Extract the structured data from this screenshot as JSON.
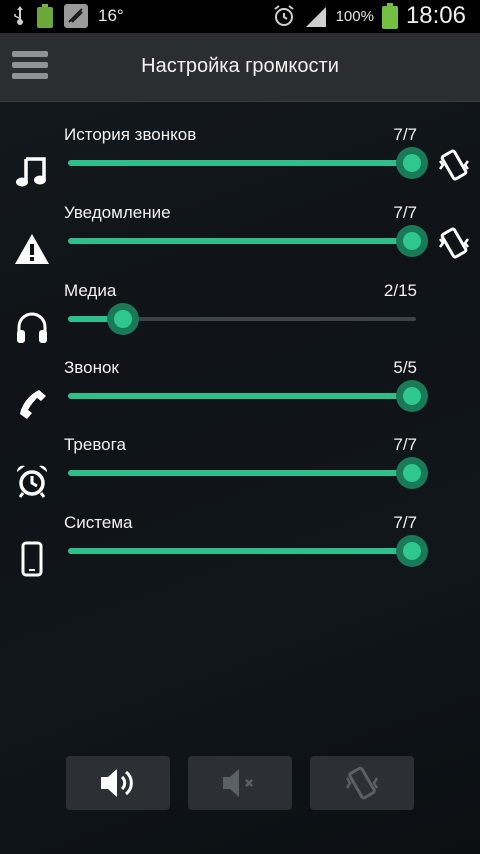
{
  "status_bar": {
    "temperature": "16°",
    "battery": "100%",
    "time": "18:06"
  },
  "header": {
    "title": "Настройка громкости"
  },
  "rows": [
    {
      "label": "История звонков",
      "value": "7/7",
      "level": 1.0,
      "icon": "music-note-icon",
      "vibrate": true
    },
    {
      "label": "Уведомление",
      "value": "7/7",
      "level": 1.0,
      "icon": "warning-icon",
      "vibrate": true
    },
    {
      "label": "Медиа",
      "value": "2/15",
      "level": 0.15,
      "icon": "headphones-icon",
      "vibrate": false
    },
    {
      "label": "Звонок",
      "value": "5/5",
      "level": 1.0,
      "icon": "phone-icon",
      "vibrate": false
    },
    {
      "label": "Тревога",
      "value": "7/7",
      "level": 1.0,
      "icon": "alarm-clock-icon",
      "vibrate": false
    },
    {
      "label": "Система",
      "value": "7/7",
      "level": 1.0,
      "icon": "smartphone-icon",
      "vibrate": false
    }
  ],
  "bottom_buttons": [
    {
      "name": "sound-on-icon",
      "active": true
    },
    {
      "name": "mute-icon",
      "active": false
    },
    {
      "name": "vibrate-mode-icon",
      "active": false
    }
  ],
  "colors": {
    "accent": "#2ec88f",
    "header": "#2b2e31",
    "background": "#11161a"
  }
}
